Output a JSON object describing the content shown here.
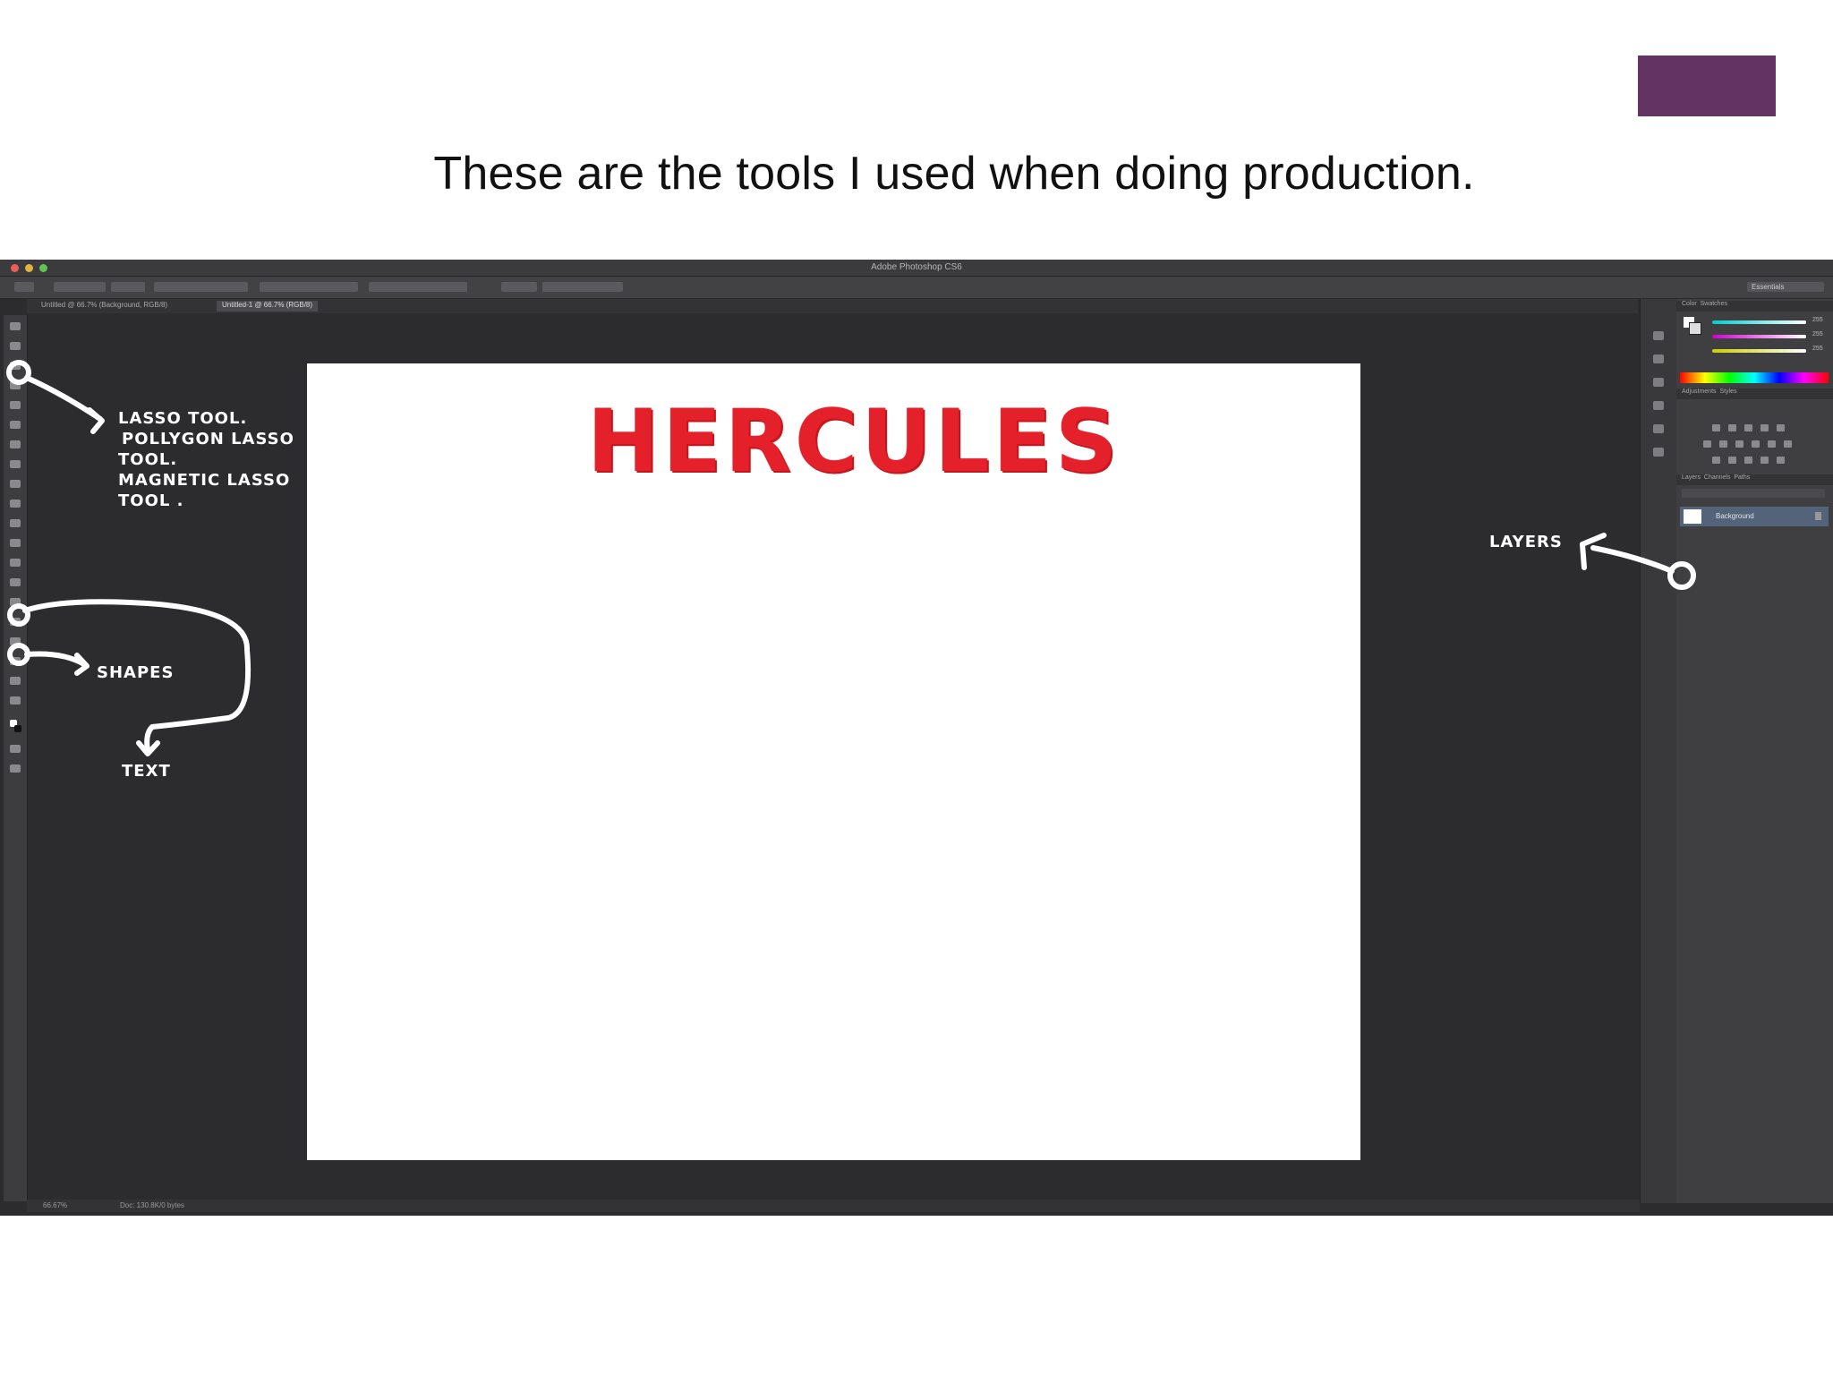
{
  "colors": {
    "accent_block": "#633463",
    "ps_background": "#2c2c2f",
    "hercules_red": "#e4202b"
  },
  "slide": {
    "title": "These are the tools I used when doing production."
  },
  "app": {
    "window_title": "Adobe Photoshop CS6",
    "workspace_label": "Essentials",
    "tabs": [
      "Untitled @ 66.7% (Background, RGB/8)",
      "Untitled-1 @ 66.7% (RGB/8)"
    ],
    "status_zoom": "66.67%",
    "status_doc": "Doc: 130.8K/0 bytes",
    "color_values": [
      "255",
      "255",
      "255"
    ],
    "layer_name": "Background"
  },
  "canvas": {
    "artwork_text": "HERCULES"
  },
  "annotations": {
    "lasso": [
      "LASSO TOOL.",
      "POLLYGON LASSO",
      "TOOL.",
      "MAGNETIC LASSO",
      "TOOL ."
    ],
    "shapes": "SHAPES",
    "text": "TEXT",
    "layers": "LAYERS"
  }
}
